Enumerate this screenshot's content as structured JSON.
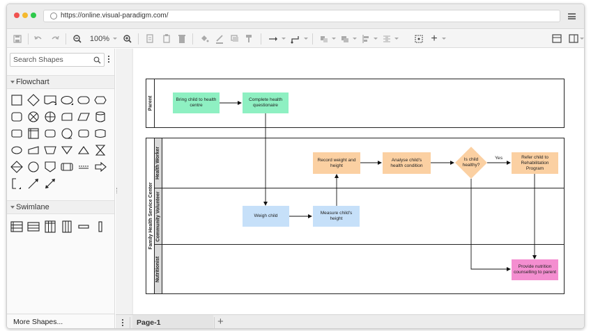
{
  "browser": {
    "url": "https://online.visual-paradigm.com/"
  },
  "toolbar": {
    "zoom_label": "100%"
  },
  "sidebar": {
    "search_placeholder": "Search Shapes",
    "sections": [
      {
        "title": "Flowchart"
      },
      {
        "title": "Swimlane"
      }
    ],
    "more_shapes_label": "More Shapes..."
  },
  "diagram": {
    "parent_pool_label": "Parent",
    "center_pool_label": "Family Health Service Center",
    "lanes": [
      {
        "label": "Health Worker"
      },
      {
        "label": "Community Volunteer"
      },
      {
        "label": "Nutritionist"
      }
    ],
    "nodes": {
      "bring_child": "Bring child to health centre",
      "complete_questionnaire": "Complete health questionaire",
      "weigh_child": "Weigh child",
      "measure_height": "Measure child's height",
      "record_weight": "Record weight and height",
      "analyse": "Analyse child's health condition",
      "decision": "Is child healthy?",
      "refer": "Refer child to Rehabilitation Program",
      "nutrition": "Provide nutrition counselling to parent"
    },
    "yes_label": "Yes",
    "colors": {
      "parent_step": "#8ef0c2",
      "volunteer_step": "#c6e0f9",
      "worker_step": "#fbd0a2",
      "nutritionist_step": "#f48ed0"
    }
  },
  "statusbar": {
    "page_tab_label": "Page-1"
  }
}
